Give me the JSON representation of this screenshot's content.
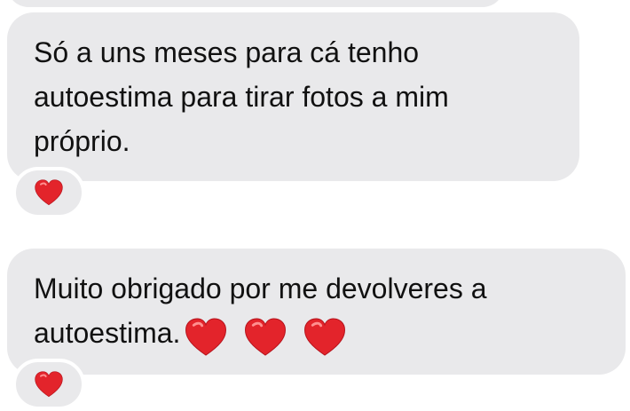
{
  "messages": [
    {
      "lines": [
        "Só a uns meses para cá tenho",
        "autoestima para tirar fotos a mim",
        "próprio."
      ],
      "reaction": {
        "icon": "red-heart-icon",
        "color": "#e3242b"
      }
    },
    {
      "lines": [
        "Muito obrigado por me devolveres a",
        "autoestima."
      ],
      "inline_icons": [
        "red-heart-icon",
        "red-heart-icon",
        "red-heart-icon"
      ],
      "reaction": {
        "icon": "red-heart-icon",
        "color": "#e3242b"
      }
    }
  ],
  "colors": {
    "bubble": "#e9e9eb",
    "text": "#111111",
    "heart": "#e3242b"
  }
}
